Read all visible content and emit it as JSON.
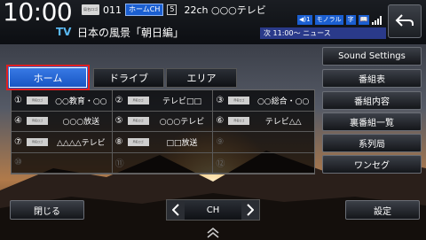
{
  "header": {
    "clock": "10:00",
    "logo_badge_text": "局名ロゴ",
    "channel_number": "011",
    "home_ch_label": "ホームCH",
    "home_ch_number": "5",
    "channel_name": "22ch ○○○テレビ",
    "tv_label": "TV",
    "program_title": "日本の風景「朝日編」",
    "status_icons": [
      "◀)1",
      "モノラル",
      "字",
      "📖"
    ],
    "next_program": "次 11:00〜 ニュース"
  },
  "tabs": [
    {
      "label": "ホーム",
      "selected": true
    },
    {
      "label": "ドライブ",
      "selected": false
    },
    {
      "label": "エリア",
      "selected": false
    }
  ],
  "channels": [
    {
      "num": "①",
      "name": "○○教育・○○",
      "has_logo": true
    },
    {
      "num": "②",
      "name": "テレビ□□",
      "has_logo": true
    },
    {
      "num": "③",
      "name": "○○総合・○○",
      "has_logo": true
    },
    {
      "num": "④",
      "name": "○○○放送",
      "has_logo": true
    },
    {
      "num": "⑤",
      "name": "○○○テレビ",
      "has_logo": true
    },
    {
      "num": "⑥",
      "name": "テレビ△△",
      "has_logo": true
    },
    {
      "num": "⑦",
      "name": "△△△△テレビ",
      "has_logo": true
    },
    {
      "num": "⑧",
      "name": "□□放送",
      "has_logo": true
    },
    {
      "num": "⑨",
      "name": "",
      "has_logo": false
    },
    {
      "num": "⑩",
      "name": "",
      "has_logo": false
    },
    {
      "num": "⑪",
      "name": "",
      "has_logo": false
    },
    {
      "num": "⑫",
      "name": "",
      "has_logo": false
    }
  ],
  "right_menu": {
    "sound_settings": "Sound Settings",
    "items": [
      "番組表",
      "番組内容",
      "裏番組一覧",
      "系列局",
      "ワンセグ"
    ]
  },
  "bottom": {
    "close_label": "閉じる",
    "ch_label": "CH",
    "settings_label": "設定"
  },
  "colors": {
    "accent_blue": "#1b5fd1",
    "selected_border": "#e02020",
    "tv_label": "#5ab8f0"
  }
}
